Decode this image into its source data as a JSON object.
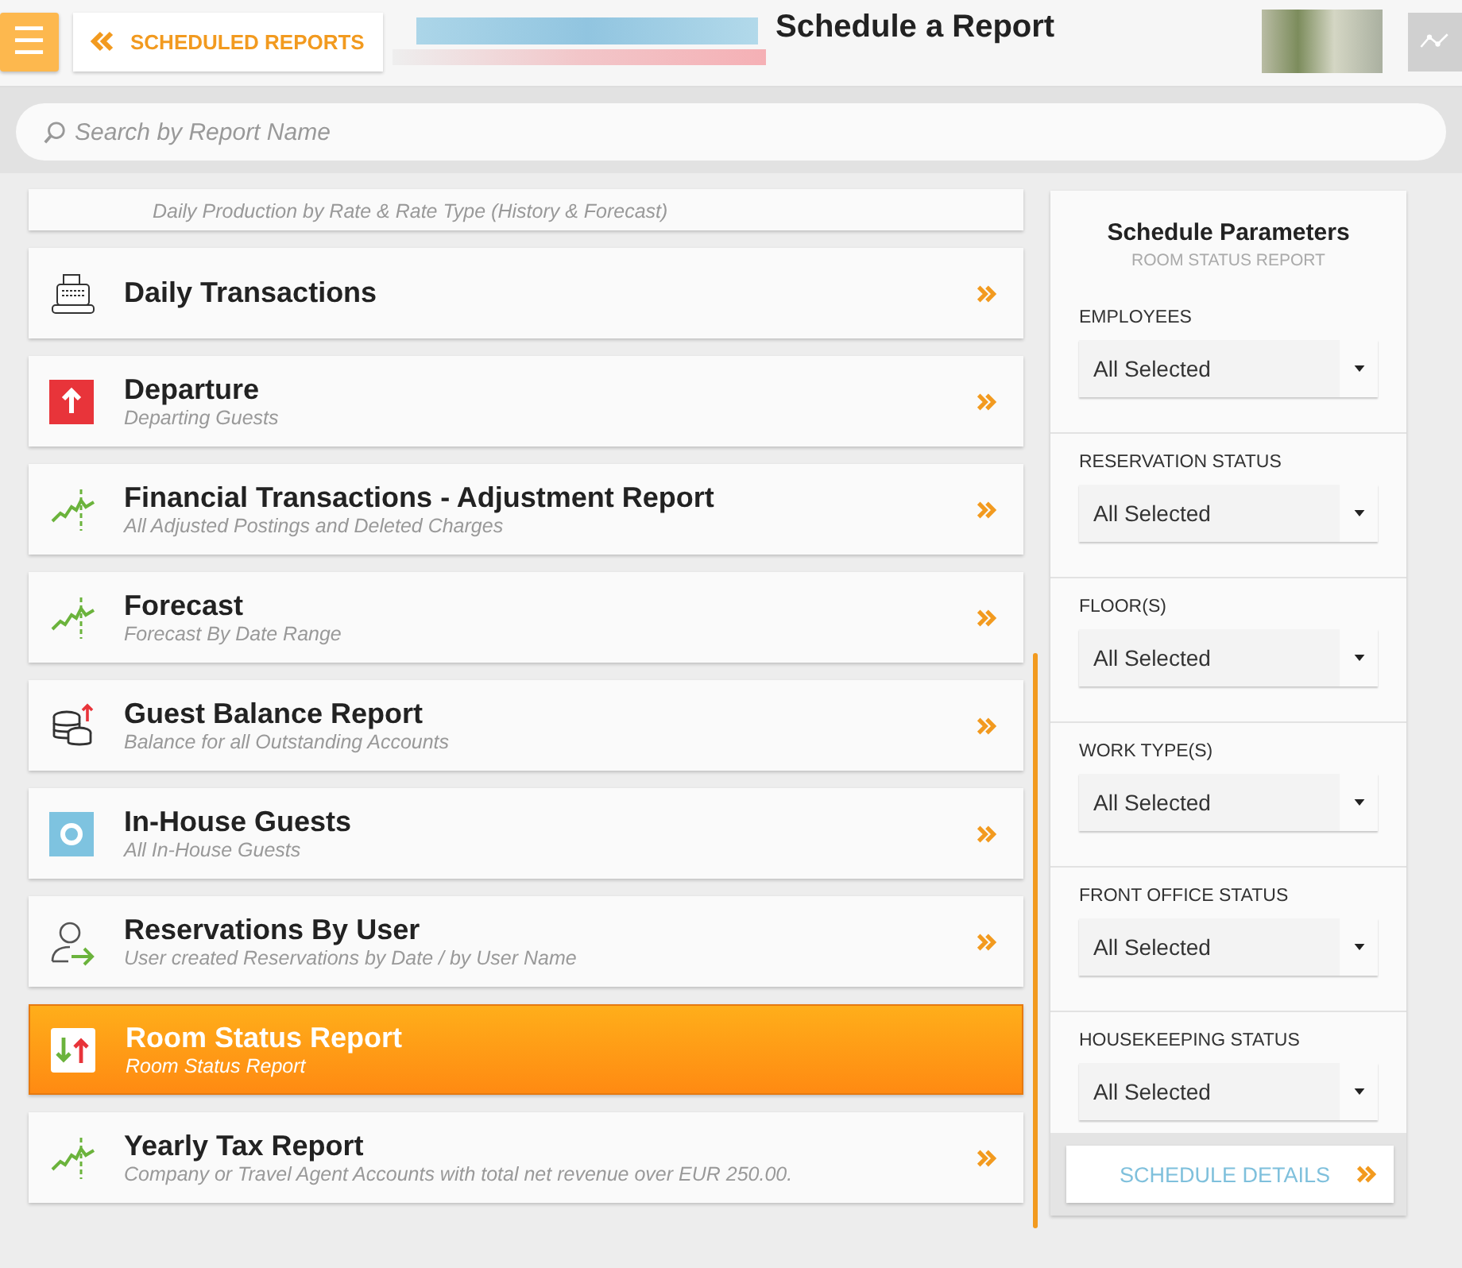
{
  "header": {
    "menu_icon": "☰",
    "back_label": "SCHEDULED REPORTS",
    "title": "Schedule a Report"
  },
  "search": {
    "placeholder": "Search by Report Name"
  },
  "reports": [
    {
      "kind": "partial",
      "subtitle": "Daily Production by Rate & Rate Type (History & Forecast)",
      "selected": false
    },
    {
      "kind": "register",
      "title": "Daily Transactions",
      "selected": false
    },
    {
      "kind": "departure",
      "title": "Departure",
      "subtitle": "Departing Guests",
      "selected": false
    },
    {
      "kind": "chart",
      "title": "Financial Transactions - Adjustment Report",
      "subtitle": "All Adjusted Postings and Deleted Charges",
      "selected": false
    },
    {
      "kind": "chart",
      "title": "Forecast",
      "subtitle": "Forecast By Date Range",
      "selected": false
    },
    {
      "kind": "coins",
      "title": "Guest Balance Report",
      "subtitle": "Balance for all Outstanding Accounts",
      "selected": false
    },
    {
      "kind": "inhouse",
      "title": "In-House Guests",
      "subtitle": "All In-House Guests",
      "selected": false
    },
    {
      "kind": "user",
      "title": "Reservations By User",
      "subtitle": "User created Reservations by Date / by User Name",
      "selected": false
    },
    {
      "kind": "updown",
      "title": "Room Status Report",
      "subtitle": "Room Status Report",
      "selected": true
    },
    {
      "kind": "chart",
      "title": "Yearly Tax Report",
      "subtitle": "Company or Travel Agent Accounts with total net revenue over EUR 250.00.",
      "selected": false
    }
  ],
  "parameters": {
    "title": "Schedule Parameters",
    "subtitle": "ROOM STATUS REPORT",
    "fields": [
      {
        "label": "EMPLOYEES",
        "value": "All Selected"
      },
      {
        "label": "RESERVATION STATUS",
        "value": "All Selected"
      },
      {
        "label": "FLOOR(S)",
        "value": "All Selected"
      },
      {
        "label": "WORK TYPE(S)",
        "value": "All Selected"
      },
      {
        "label": "FRONT OFFICE STATUS",
        "value": "All Selected"
      },
      {
        "label": "HOUSEKEEPING STATUS",
        "value": "All Selected"
      }
    ],
    "button": "SCHEDULE DETAILS"
  }
}
